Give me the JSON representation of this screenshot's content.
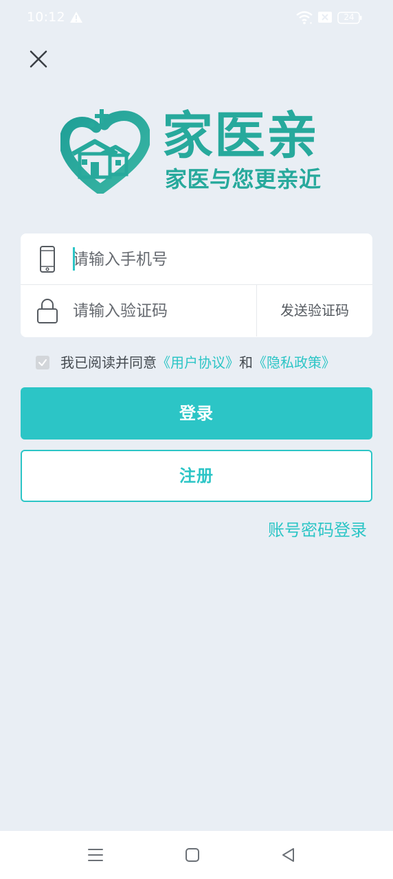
{
  "status_bar": {
    "time": "10:12",
    "battery": "24",
    "icons": [
      "warning-icon",
      "wifi-icon",
      "sim-disabled-icon",
      "battery-icon"
    ]
  },
  "header": {
    "close_icon": "close-icon"
  },
  "logo": {
    "title": "家医亲",
    "slogan": "家医与您更亲近",
    "mark_icon": "heart-house-icon",
    "brand_color": "#27a99c"
  },
  "form": {
    "phone": {
      "placeholder": "请输入手机号",
      "value": "",
      "icon": "phone-icon"
    },
    "code": {
      "placeholder": "请输入验证码",
      "value": "",
      "icon": "lock-icon"
    },
    "send_code_label": "发送验证码"
  },
  "agreement": {
    "checked": true,
    "prefix": "我已阅读并同意",
    "user_agreement": "《用户协议》",
    "conjunction": "和",
    "privacy_policy": "《隐私政策》"
  },
  "actions": {
    "login_label": "登录",
    "register_label": "注册",
    "password_login_label": "账号密码登录"
  },
  "colors": {
    "accent": "#2cc5c6",
    "background": "#e9eef4",
    "text": "#444a50"
  },
  "nav_bar": {
    "icons": [
      "menu-icon",
      "home-icon",
      "back-icon"
    ]
  }
}
